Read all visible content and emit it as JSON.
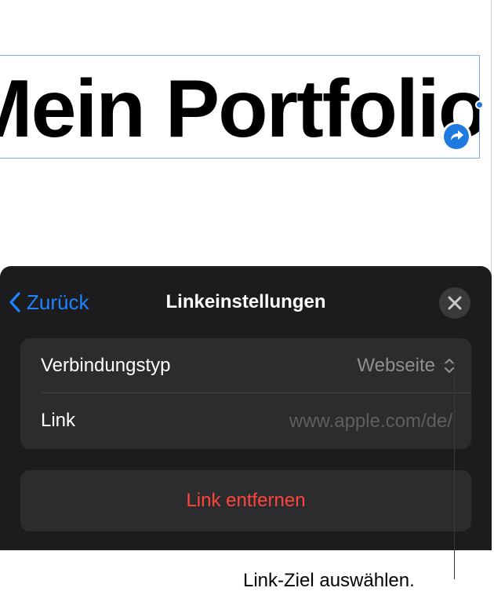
{
  "canvas": {
    "title_text": "Mein Portfolio"
  },
  "link_settings": {
    "back_label": "Zurück",
    "title": "Linkeinstellungen",
    "rows": [
      {
        "label": "Verbindungstyp",
        "value": "Webseite"
      },
      {
        "label": "Link",
        "value": "www.apple.com/de/"
      }
    ],
    "remove_label": "Link entfernen"
  },
  "callout": {
    "text": "Link-Ziel auswählen."
  },
  "colors": {
    "accent": "#1f84ff",
    "destructive": "#ff453a",
    "sheet_background": "#1c1c1e",
    "group_background": "#2c2c2e"
  },
  "icons": [
    "chevron-left-icon",
    "close-icon",
    "up-down-chevron-icon",
    "link-arrow-icon"
  ]
}
